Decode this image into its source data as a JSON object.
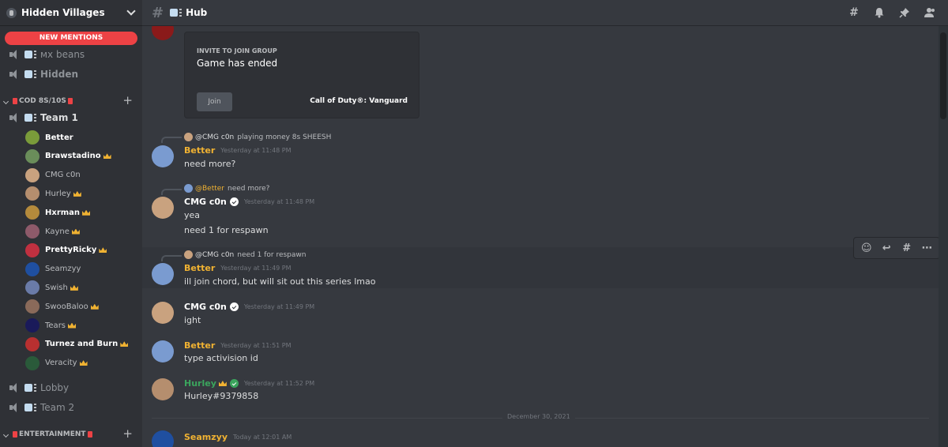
{
  "server": {
    "name": "Hidden Villages"
  },
  "sidebar": {
    "new_mentions": "NEW MENTIONS",
    "channels_top": [
      {
        "name": "ᴍх beans"
      },
      {
        "name": "Hidden"
      }
    ],
    "category_cod": {
      "name": "COD 8S/10S"
    },
    "team1": {
      "name": "Team 1"
    },
    "members": [
      {
        "name": "Better",
        "crown": false,
        "bold": true,
        "color": "#7a9b3a"
      },
      {
        "name": "Brawstadino",
        "crown": true,
        "bold": true,
        "color": "#6a8d5a"
      },
      {
        "name": "CMG c0n",
        "crown": false,
        "bold": false,
        "color": "#c9a27f"
      },
      {
        "name": "Hurley",
        "crown": true,
        "bold": false,
        "color": "#b58e6e"
      },
      {
        "name": "Hxrman",
        "crown": true,
        "bold": true,
        "color": "#b48a3c"
      },
      {
        "name": "Kayne",
        "crown": true,
        "bold": false,
        "color": "#8e5a6a"
      },
      {
        "name": "PrettyRicky",
        "crown": true,
        "bold": true,
        "color": "#c03040"
      },
      {
        "name": "Seamzyy",
        "crown": false,
        "bold": false,
        "color": "#1f4fa0"
      },
      {
        "name": "Swish",
        "crown": true,
        "bold": false,
        "color": "#6a7ba8"
      },
      {
        "name": "SwooBaloo",
        "crown": true,
        "bold": false,
        "color": "#8a6a5a"
      },
      {
        "name": "Tears",
        "crown": true,
        "bold": false,
        "color": "#1a1a5a"
      },
      {
        "name": "Turnez and Burn",
        "crown": true,
        "bold": true,
        "color": "#b83030"
      },
      {
        "name": "Veracity",
        "crown": true,
        "bold": false,
        "color": "#2a5a3a"
      }
    ],
    "lobby": {
      "name": "Lobby"
    },
    "team2": {
      "name": "Team 2"
    },
    "category_ent": {
      "name": "ENTERTAINMENT"
    }
  },
  "topbar": {
    "channel": "Hub"
  },
  "invite": {
    "label": "INVITE TO JOIN GROUP",
    "title": "Game has ended",
    "join": "Join",
    "game": "Call of Duty®: Vanguard"
  },
  "messages": [
    {
      "reply_to": "@CMG c0n",
      "reply_text": "playing money 8s SHEESH",
      "author": "Better",
      "color": "#f0b232",
      "time": "Yesterday at 11:48 PM",
      "lines": [
        "need more?"
      ]
    },
    {
      "reply_to": "@Better",
      "reply_text": "need more?",
      "author": "CMG c0n",
      "color": "#ffffff",
      "time": "Yesterday at 11:48 PM",
      "lines": [
        "yea",
        "need 1 for respawn"
      ]
    },
    {
      "reply_to": "@CMG c0n",
      "reply_text": "need 1 for respawn",
      "author": "Better",
      "color": "#f0b232",
      "time": "Yesterday at 11:49 PM",
      "lines": [
        "ill join chord, but will sit out this series lmao"
      ]
    },
    {
      "author": "CMG c0n",
      "color": "#ffffff",
      "time": "Yesterday at 11:49 PM",
      "lines": [
        "ight"
      ]
    },
    {
      "author": "Better",
      "color": "#f0b232",
      "time": "Yesterday at 11:51 PM",
      "lines": [
        "type activision id"
      ]
    },
    {
      "author": "Hurley",
      "color": "#3ba55d",
      "time": "Yesterday at 11:52 PM",
      "lines": [
        "Hurley#9379858"
      ]
    },
    {
      "author": "Seamzyy",
      "color": "#f0b232",
      "time": "Today at 12:01 AM",
      "lines": [
        ""
      ]
    }
  ],
  "date_divider": "December 30, 2021"
}
